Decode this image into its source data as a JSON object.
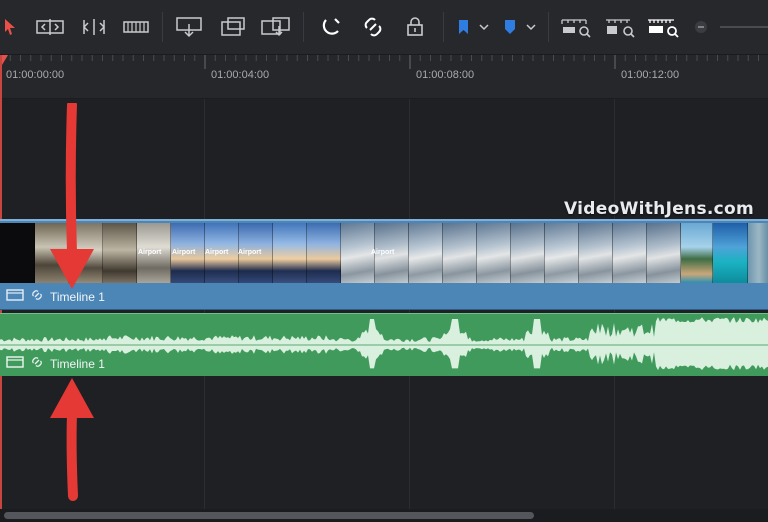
{
  "toolbar": {
    "icons": [
      "selection-arrow-icon",
      "trim-mode-icon",
      "dynamic-trim-icon",
      "blade-icon",
      "insert-clip-icon",
      "overwrite-clip-icon",
      "replace-clip-icon",
      "snapping-icon",
      "linked-selection-icon",
      "position-lock-icon",
      "flag-icon",
      "marker-icon",
      "zoom-full-icon",
      "zoom-detail-icon",
      "zoom-custom-icon"
    ],
    "accent_color": "#e8504a"
  },
  "ruler": {
    "timecodes": [
      "01:00:00:00",
      "01:00:04:00",
      "01:00:08:00",
      "01:00:12:00"
    ]
  },
  "video_track": {
    "clip_name": "Timeline 1",
    "color": "#4b86b6",
    "thumb_text": "Airport"
  },
  "audio_track": {
    "clip_name": "Timeline 1",
    "color": "#3f9a5c"
  },
  "watermark": "VideoWithJens.com",
  "annotations": {
    "arrow_color": "#e53935"
  }
}
